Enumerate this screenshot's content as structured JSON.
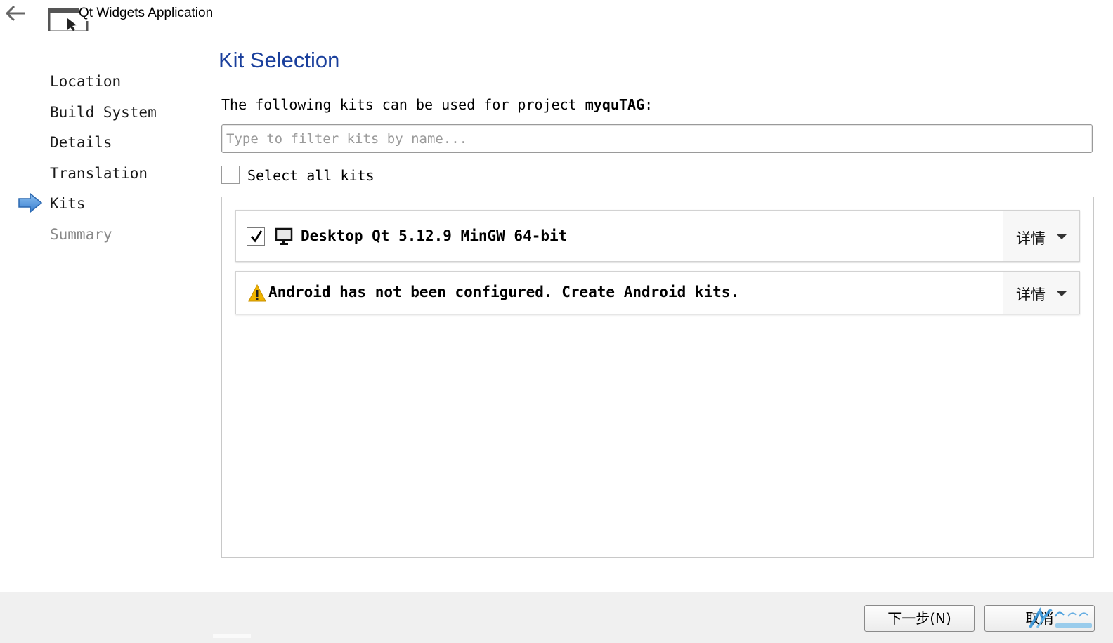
{
  "window": {
    "title": "Qt Widgets Application"
  },
  "steps": [
    {
      "label": "Location",
      "state": "done"
    },
    {
      "label": "Build System",
      "state": "done"
    },
    {
      "label": "Details",
      "state": "done"
    },
    {
      "label": "Translation",
      "state": "done"
    },
    {
      "label": "Kits",
      "state": "current"
    },
    {
      "label": "Summary",
      "state": "pending"
    }
  ],
  "page": {
    "title": "Kit Selection",
    "intro_prefix": "The following kits can be used for project ",
    "project_name": "myquTAG",
    "intro_suffix": ":",
    "filter_placeholder": "Type to filter kits by name...",
    "filter_value": "",
    "select_all_label": "Select all kits",
    "select_all_checked": false
  },
  "kits": [
    {
      "label": "Desktop Qt 5.12.9 MinGW 64-bit",
      "checked": true,
      "icon": "monitor-icon",
      "details_label": "详情"
    },
    {
      "label": "Android has not been configured. Create Android kits.",
      "icon": "warning-icon",
      "details_label": "详情"
    }
  ],
  "buttons": {
    "next": "下一步(N)",
    "cancel": "取消"
  },
  "colors": {
    "title_blue": "#1a3f9c",
    "current_step_arrow": "#4a90d9",
    "warning": "#f0b400"
  }
}
